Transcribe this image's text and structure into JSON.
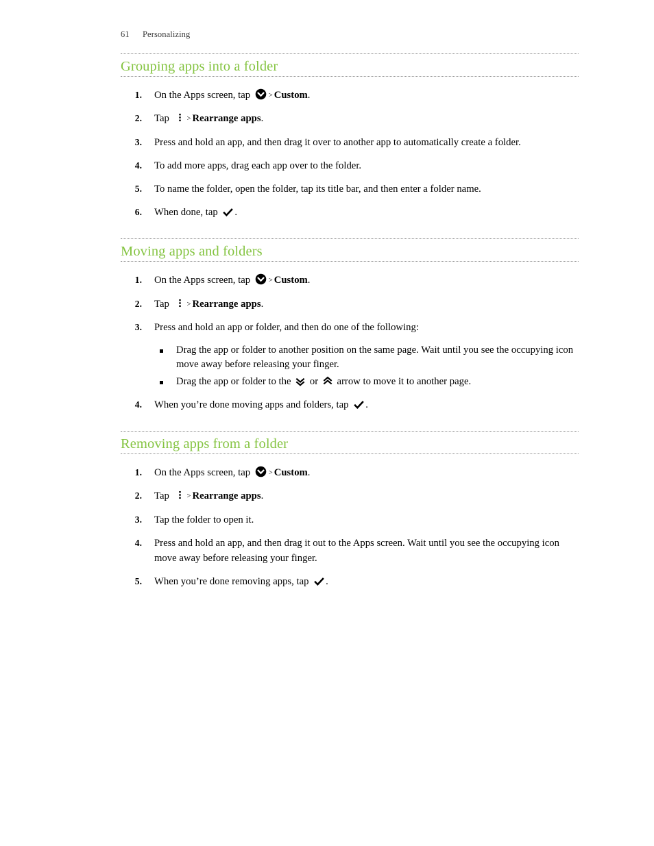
{
  "header": {
    "page_number": "61",
    "chapter": "Personalizing"
  },
  "theme": {
    "heading_color": "#85c442",
    "text_color": "#000000",
    "rule_color": "#8a8a8a",
    "background": "#ffffff"
  },
  "sections": [
    {
      "id": "grouping-apps-into-a-folder",
      "heading": "Grouping apps into a folder",
      "steps": [
        {
          "num": "1.",
          "parts": [
            {
              "type": "text",
              "text": "On the Apps screen, tap "
            },
            {
              "type": "icon",
              "icon": "circle-chevron-down-icon"
            },
            {
              "type": "sep",
              "text": ">"
            },
            {
              "type": "bold",
              "text": "Custom"
            },
            {
              "type": "text",
              "text": "."
            }
          ]
        },
        {
          "num": "2.",
          "parts": [
            {
              "type": "text",
              "text": "Tap "
            },
            {
              "type": "icon",
              "icon": "kebab-menu-icon"
            },
            {
              "type": "sep",
              "text": ">"
            },
            {
              "type": "bold",
              "text": "Rearrange apps"
            },
            {
              "type": "text",
              "text": "."
            }
          ]
        },
        {
          "num": "3.",
          "parts": [
            {
              "type": "text",
              "text": "Press and hold an app, and then drag it over to another app to automatically create a folder."
            }
          ]
        },
        {
          "num": "4.",
          "parts": [
            {
              "type": "text",
              "text": "To add more apps, drag each app over to the folder."
            }
          ]
        },
        {
          "num": "5.",
          "parts": [
            {
              "type": "text",
              "text": "To name the folder, open the folder, tap its title bar, and then enter a folder name."
            }
          ]
        },
        {
          "num": "6.",
          "parts": [
            {
              "type": "text",
              "text": "When done, tap "
            },
            {
              "type": "icon",
              "icon": "check-icon"
            },
            {
              "type": "text",
              "text": "."
            }
          ]
        }
      ]
    },
    {
      "id": "moving-apps-and-folders",
      "heading": "Moving apps and folders",
      "steps": [
        {
          "num": "1.",
          "parts": [
            {
              "type": "text",
              "text": "On the Apps screen, tap "
            },
            {
              "type": "icon",
              "icon": "circle-chevron-down-icon"
            },
            {
              "type": "sep",
              "text": ">"
            },
            {
              "type": "bold",
              "text": "Custom"
            },
            {
              "type": "text",
              "text": "."
            }
          ]
        },
        {
          "num": "2.",
          "parts": [
            {
              "type": "text",
              "text": "Tap "
            },
            {
              "type": "icon",
              "icon": "kebab-menu-icon"
            },
            {
              "type": "sep",
              "text": ">"
            },
            {
              "type": "bold",
              "text": "Rearrange apps"
            },
            {
              "type": "text",
              "text": "."
            }
          ]
        },
        {
          "num": "3.",
          "parts": [
            {
              "type": "text",
              "text": "Press and hold an app or folder, and then do one of the following:"
            }
          ],
          "bullets": [
            {
              "parts": [
                {
                  "type": "text",
                  "text": "Drag the app or folder to another position on the same page. Wait until you see the occupying icon move away before releasing your finger."
                }
              ]
            },
            {
              "parts": [
                {
                  "type": "text",
                  "text": "Drag the app or folder to the "
                },
                {
                  "type": "icon",
                  "icon": "double-chevron-down-icon"
                },
                {
                  "type": "text",
                  "text": " or "
                },
                {
                  "type": "icon",
                  "icon": "double-chevron-up-icon"
                },
                {
                  "type": "text",
                  "text": " arrow to move it to another page."
                }
              ]
            }
          ]
        },
        {
          "num": "4.",
          "parts": [
            {
              "type": "text",
              "text": "When you’re done moving apps and folders, tap "
            },
            {
              "type": "icon",
              "icon": "check-icon"
            },
            {
              "type": "text",
              "text": "."
            }
          ]
        }
      ]
    },
    {
      "id": "removing-apps-from-a-folder",
      "heading": "Removing apps from a folder",
      "steps": [
        {
          "num": "1.",
          "parts": [
            {
              "type": "text",
              "text": "On the Apps screen, tap "
            },
            {
              "type": "icon",
              "icon": "circle-chevron-down-icon"
            },
            {
              "type": "sep",
              "text": ">"
            },
            {
              "type": "bold",
              "text": "Custom"
            },
            {
              "type": "text",
              "text": "."
            }
          ]
        },
        {
          "num": "2.",
          "parts": [
            {
              "type": "text",
              "text": "Tap "
            },
            {
              "type": "icon",
              "icon": "kebab-menu-icon"
            },
            {
              "type": "sep",
              "text": ">"
            },
            {
              "type": "bold",
              "text": "Rearrange apps"
            },
            {
              "type": "text",
              "text": "."
            }
          ]
        },
        {
          "num": "3.",
          "parts": [
            {
              "type": "text",
              "text": "Tap the folder to open it."
            }
          ]
        },
        {
          "num": "4.",
          "parts": [
            {
              "type": "text",
              "text": "Press and hold an app, and then drag it out to the Apps screen. Wait until you see the occupying icon move away before releasing your finger."
            }
          ]
        },
        {
          "num": "5.",
          "parts": [
            {
              "type": "text",
              "text": "When you’re done removing apps, tap "
            },
            {
              "type": "icon",
              "icon": "check-icon"
            },
            {
              "type": "text",
              "text": "."
            }
          ]
        }
      ]
    }
  ]
}
